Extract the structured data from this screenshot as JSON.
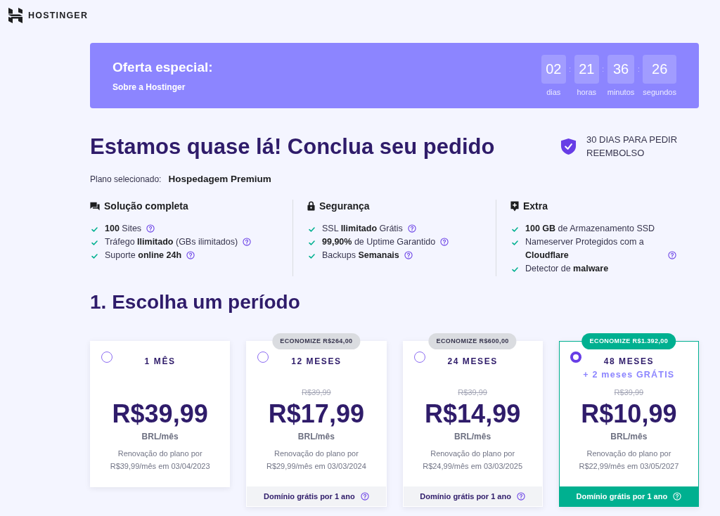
{
  "logo": {
    "text": "HOSTINGER"
  },
  "offer": {
    "title": "Oferta especial:",
    "link": "Sobre a Hostinger",
    "countdown": [
      {
        "value": "02",
        "unit": "dias",
        "separator": ":"
      },
      {
        "value": "21",
        "unit": "horas",
        "separator": ":"
      },
      {
        "value": "36",
        "unit": "minutos",
        "separator": ":"
      },
      {
        "value": "26",
        "unit": "segundos"
      }
    ]
  },
  "heading": "Estamos quase lá! Conclua seu pedido",
  "guarantee": {
    "text": "30 DIAS PARA PEDIR REEMBOLSO"
  },
  "selected_plan": {
    "label": "Plano selecionado:",
    "value": "Hospedagem Premium"
  },
  "features": [
    {
      "kind": "chat",
      "title": "Solução completa",
      "items": [
        {
          "text": "**100** Sites",
          "help": true
        },
        {
          "text": "Tráfego **Ilimitado** (GBs ilimitados)",
          "help": true
        },
        {
          "text": "Suporte **online 24h**",
          "help": true
        }
      ]
    },
    {
      "kind": "lock",
      "title": "Segurança",
      "items": [
        {
          "text": "SSL **Ilimitado** Grátis",
          "help": true
        },
        {
          "text": "**99,90%** de Uptime Garantido",
          "help": true
        },
        {
          "text": "Backups **Semanais**",
          "help": true
        }
      ]
    },
    {
      "kind": "plus",
      "title": "Extra",
      "items": [
        {
          "text": "**100 GB** de Armazenamento SSD",
          "help": false
        },
        {
          "text": "Nameserver Protegidos com a **Cloudflare**",
          "help": true
        },
        {
          "text": "Detector de **malware**",
          "help": false
        }
      ]
    }
  ],
  "period": {
    "heading": "1. Escolha um período",
    "plans": [
      {
        "label": "1 MÊS",
        "selected": false,
        "price": "R$39,99",
        "unit": "BRL/mês",
        "renewal": "Renovação do plano por R$39,99/mês em 03/04/2023"
      },
      {
        "badge": "ECONOMIZE R$264,00",
        "label": "12 MESES",
        "selected": false,
        "old_price": "R$39,99",
        "price": "R$17,99",
        "unit": "BRL/mês",
        "renewal": "Renovação do plano por R$29,99/mês em 03/03/2024",
        "footer": "Domínio grátis por 1 ano"
      },
      {
        "badge": "ECONOMIZE R$600,00",
        "label": "24 MESES",
        "selected": false,
        "old_price": "R$39,99",
        "price": "R$14,99",
        "unit": "BRL/mês",
        "renewal": "Renovação do plano por R$24,99/mês em 03/03/2025",
        "footer": "Domínio grátis por 1 ano"
      },
      {
        "badge": "ECONOMIZE R$1.392,00",
        "label": "48 MESES",
        "bonus": "+ 2 meses GRÁTIS",
        "selected": true,
        "old_price": "R$39,99",
        "price": "R$10,99",
        "unit": "BRL/mês",
        "renewal": "Renovação do plano por R$22,99/mês em 03/05/2027",
        "footer": "Domínio grátis por 1 ano"
      }
    ]
  }
}
